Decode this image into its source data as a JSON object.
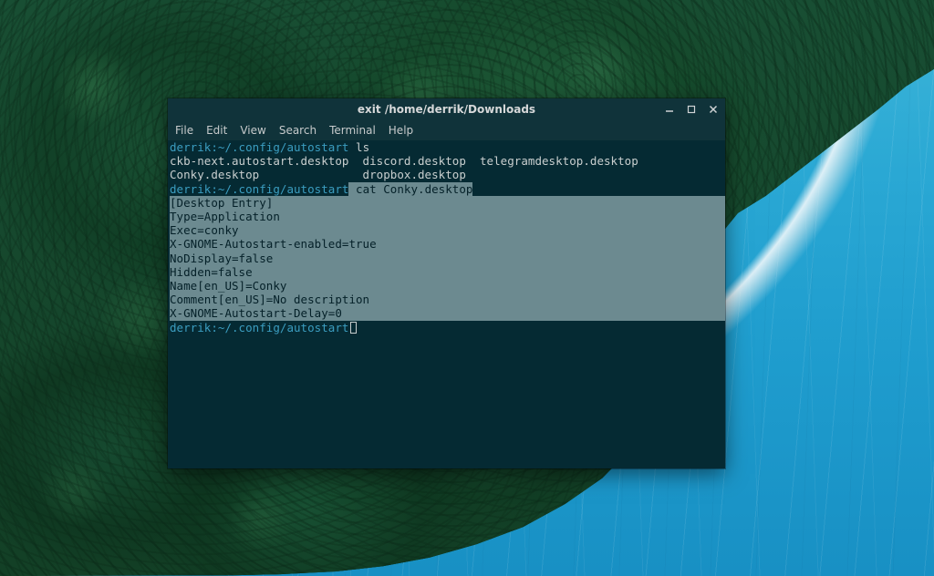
{
  "window": {
    "title": "exit /home/derrik/Downloads",
    "controls": {
      "minimize": "—",
      "maximize": "▢",
      "close": "✕"
    }
  },
  "menu": {
    "file": "File",
    "edit": "Edit",
    "view": "View",
    "search": "Search",
    "terminal": "Terminal",
    "help": "Help"
  },
  "terminal": {
    "prompt": "derrik:~/.config/autostart",
    "cmd_ls": " ls",
    "ls_out_line1": "ckb-next.autostart.desktop  discord.desktop  telegramdesktop.desktop",
    "ls_out_line2": "Conky.desktop               dropbox.desktop",
    "cmd_cat": " cat Conky.desktop",
    "cat_lines": [
      "[Desktop Entry]",
      "Type=Application",
      "Exec=conky",
      "X-GNOME-Autostart-enabled=true",
      "NoDisplay=false",
      "Hidden=false",
      "Name[en_US]=Conky",
      "Comment[en_US]=No description",
      "X-GNOME-Autostart-Delay=0"
    ]
  }
}
